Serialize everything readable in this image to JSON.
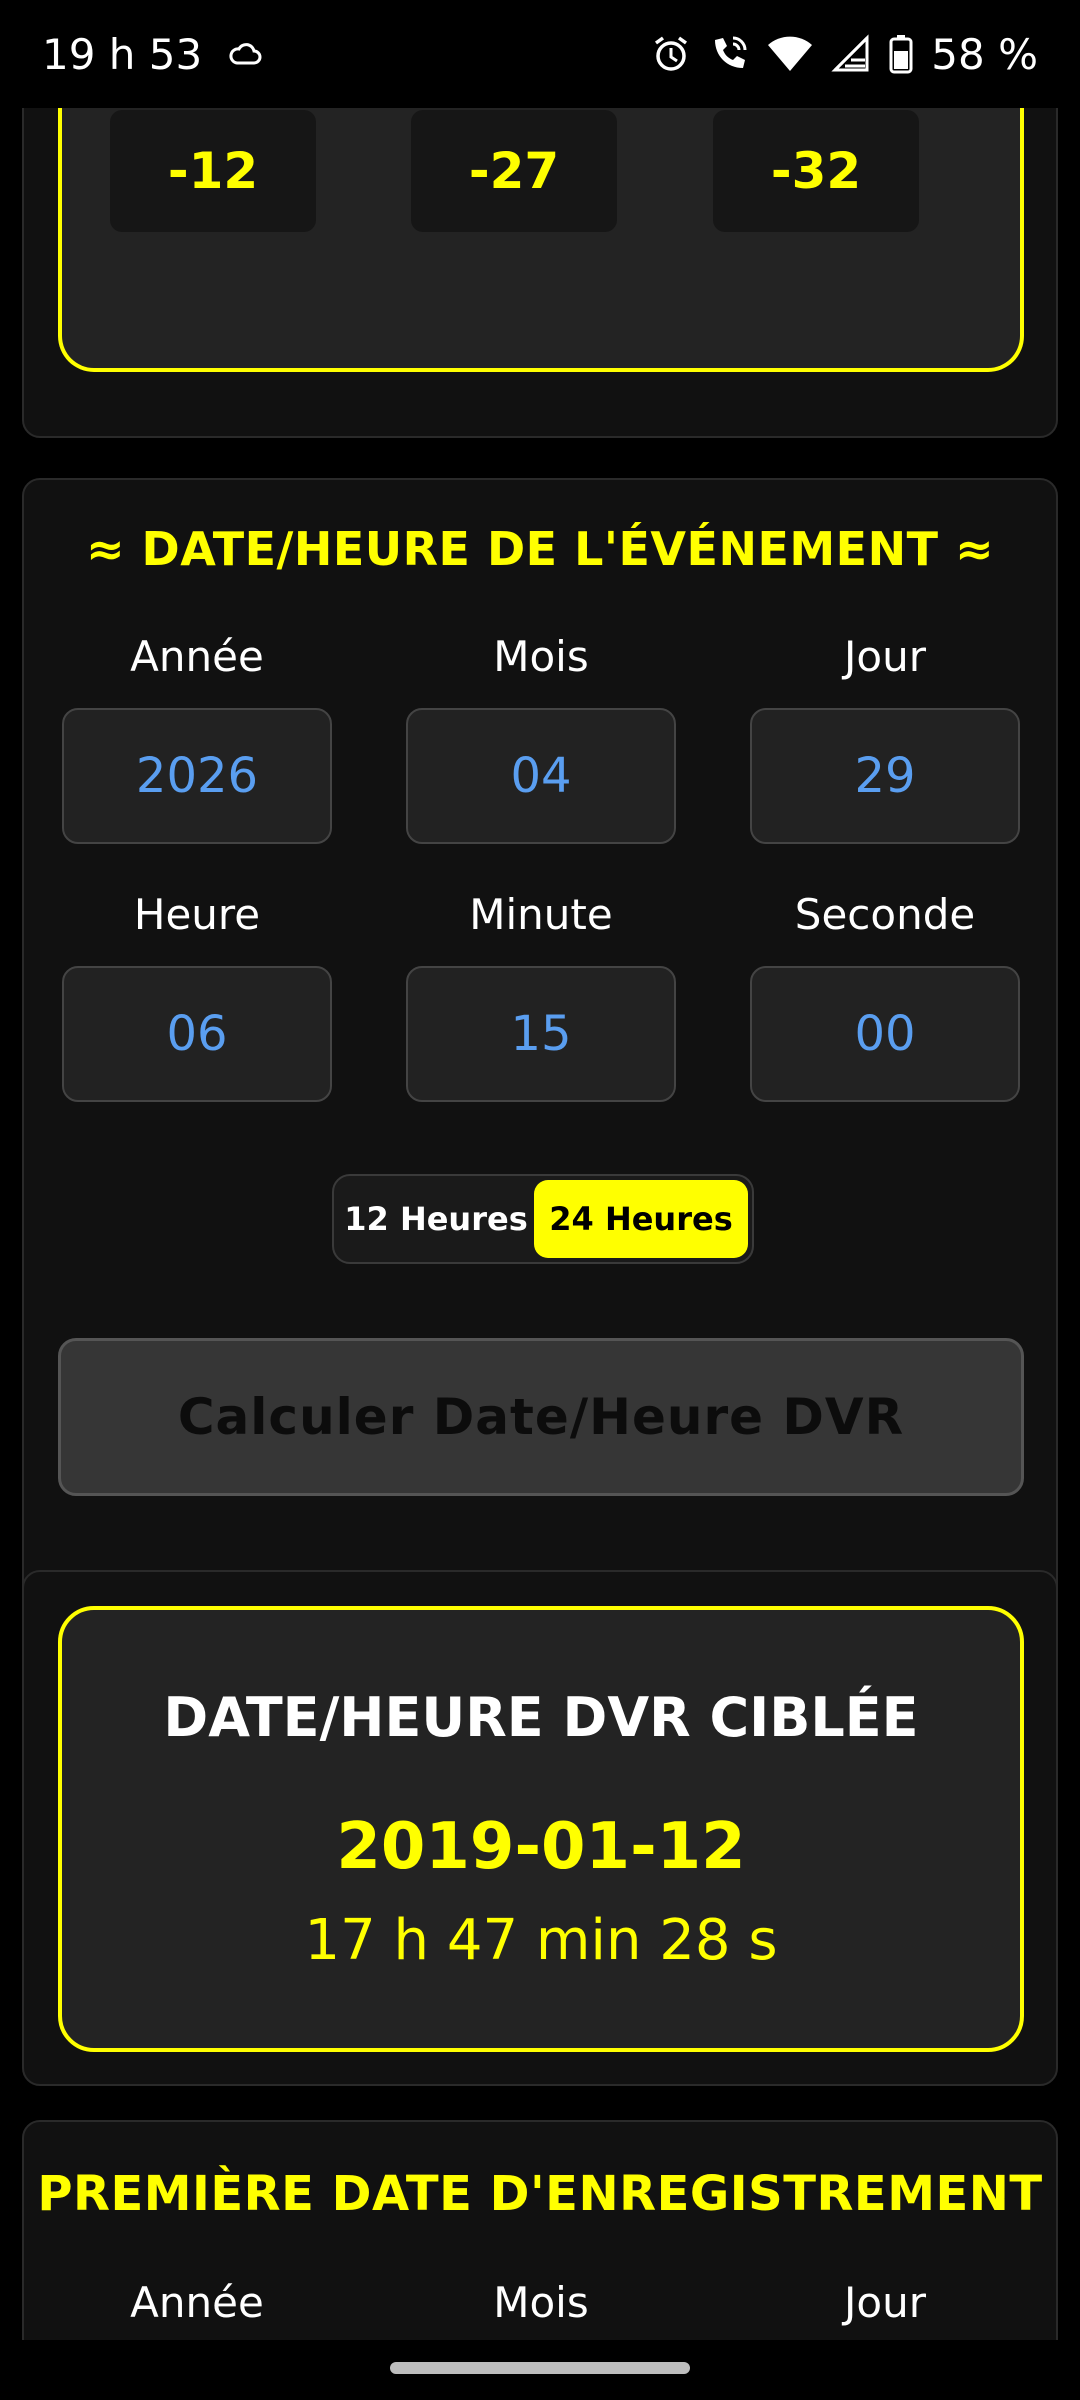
{
  "status_bar": {
    "time": "19 h 53",
    "battery": "58 %",
    "icons": [
      "cloud-icon",
      "alarm-icon",
      "wifi-calling-icon",
      "wifi-icon",
      "signal-icon",
      "battery-icon"
    ]
  },
  "offsets": {
    "values": [
      "-12",
      "-27",
      "-32"
    ]
  },
  "event": {
    "title": "≈ DATE/HEURE DE L'ÉVÉNEMENT ≈",
    "labels": {
      "year": "Année",
      "month": "Mois",
      "day": "Jour",
      "hour": "Heure",
      "minute": "Minute",
      "second": "Seconde"
    },
    "values": {
      "year": "2026",
      "month": "04",
      "day": "29",
      "hour": "06",
      "minute": "15",
      "second": "00"
    },
    "toggle": {
      "option_12": "12 Heures",
      "option_24": "24 Heures",
      "selected": "24 Heures"
    },
    "calculate_label": "Calculer Date/Heure DVR"
  },
  "result": {
    "title": "DATE/HEURE DVR CIBLÉE",
    "date": "2019-01-12",
    "time": "17 h 47 min 28 s"
  },
  "first_recording": {
    "title": "PREMIÈRE DATE D'ENREGISTREMENT",
    "labels": {
      "year": "Année",
      "month": "Mois",
      "day": "Jour"
    }
  },
  "colors": {
    "accent": "#ffff00",
    "value_blue": "#5a9ef0",
    "background": "#000000",
    "card": "#111111"
  }
}
